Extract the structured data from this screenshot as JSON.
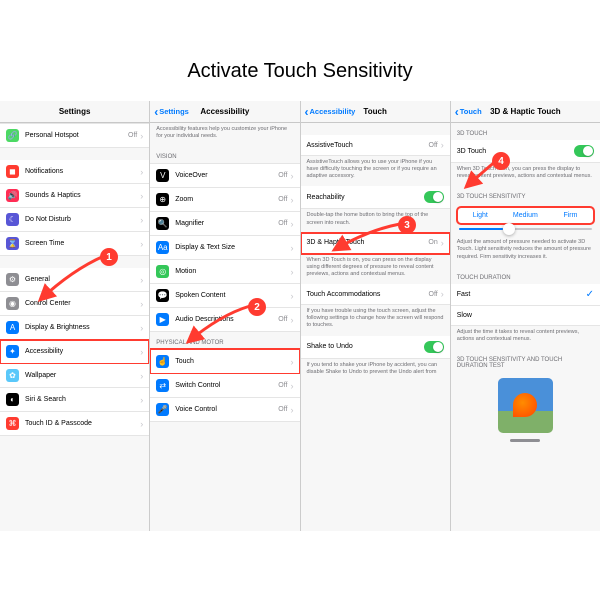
{
  "title": "Activate Touch Sensitivity",
  "panel1": {
    "header": "Settings",
    "items": [
      {
        "icon": "🔗",
        "bg": "#4cd964",
        "label": "Personal Hotspot",
        "value": "Off"
      },
      {
        "icon": "◼",
        "bg": "#ff3b30",
        "label": "Notifications"
      },
      {
        "icon": "🔊",
        "bg": "#ff2d55",
        "label": "Sounds & Haptics"
      },
      {
        "icon": "☾",
        "bg": "#5856d6",
        "label": "Do Not Disturb"
      },
      {
        "icon": "⌛",
        "bg": "#5856d6",
        "label": "Screen Time"
      },
      {
        "icon": "⚙",
        "bg": "#8e8e93",
        "label": "General"
      },
      {
        "icon": "◉",
        "bg": "#8e8e93",
        "label": "Control Center"
      },
      {
        "icon": "A",
        "bg": "#007aff",
        "label": "Display & Brightness"
      },
      {
        "icon": "✦",
        "bg": "#007aff",
        "label": "Accessibility",
        "highlight": true
      },
      {
        "icon": "✿",
        "bg": "#5ac8fa",
        "label": "Wallpaper"
      },
      {
        "icon": "◐",
        "bg": "#000",
        "label": "Siri & Search"
      },
      {
        "icon": "⌘",
        "bg": "#ff3b30",
        "label": "Touch ID & Passcode"
      }
    ]
  },
  "panel2": {
    "back": "Settings",
    "header": "Accessibility",
    "intro": "Accessibility features help you customize your iPhone for your individual needs.",
    "section1": "VISION",
    "vision": [
      {
        "icon": "V",
        "bg": "#000",
        "label": "VoiceOver",
        "value": "Off"
      },
      {
        "icon": "⊕",
        "bg": "#000",
        "label": "Zoom",
        "value": "Off"
      },
      {
        "icon": "🔍",
        "bg": "#000",
        "label": "Magnifier",
        "value": "Off"
      },
      {
        "icon": "Aa",
        "bg": "#007aff",
        "label": "Display & Text Size"
      },
      {
        "icon": "◎",
        "bg": "#34c759",
        "label": "Motion"
      },
      {
        "icon": "💬",
        "bg": "#000",
        "label": "Spoken Content"
      },
      {
        "icon": "▶",
        "bg": "#007aff",
        "label": "Audio Descriptions",
        "value": "Off"
      }
    ],
    "section2": "PHYSICAL AND MOTOR",
    "motor": [
      {
        "icon": "☝",
        "bg": "#007aff",
        "label": "Touch",
        "highlight": true
      },
      {
        "icon": "⇄",
        "bg": "#007aff",
        "label": "Switch Control",
        "value": "Off"
      },
      {
        "icon": "🎤",
        "bg": "#007aff",
        "label": "Voice Control",
        "value": "Off"
      }
    ]
  },
  "panel3": {
    "back": "Accessibility",
    "header": "Touch",
    "assistive": {
      "label": "AssistiveTouch",
      "value": "Off",
      "desc": "AssistiveTouch allows you to use your iPhone if you have difficulty touching the screen or if you require an adaptive accessory."
    },
    "reach": {
      "label": "Reachability",
      "on": true,
      "desc": "Double-tap the home button to bring the top of the screen into reach."
    },
    "haptic": {
      "label": "3D & Haptic Touch",
      "value": "On",
      "desc": "When 3D Touch is on, you can press on the display using different degrees of pressure to reveal content previews, actions and contextual menus."
    },
    "accom": {
      "label": "Touch Accommodations",
      "value": "Off",
      "desc": "If you have trouble using the touch screen, adjust the following settings to change how the screen will respond to touches."
    },
    "shake": {
      "label": "Shake to Undo",
      "on": true,
      "desc": "If you tend to shake your iPhone by accident, you can disable Shake to Undo to prevent the Undo alert from"
    }
  },
  "panel4": {
    "back": "Touch",
    "header": "3D & Haptic Touch",
    "sec1": "3D TOUCH",
    "toggle": {
      "label": "3D Touch",
      "desc": "When 3D Touch is on, you can press the display to reveal content previews, actions and contextual menus."
    },
    "sec2": "3D TOUCH SENSITIVITY",
    "seg": [
      "Light",
      "Medium",
      "Firm"
    ],
    "segDesc": "Adjust the amount of pressure needed to activate 3D Touch. Light sensitivity reduces the amount of pressure required. Firm sensitivity increases it.",
    "sec3": "TOUCH DURATION",
    "dur": [
      {
        "label": "Fast",
        "sel": true
      },
      {
        "label": "Slow"
      }
    ],
    "durDesc": "Adjust the time it takes to reveal content previews, actions and contextual menus.",
    "sec4": "3D TOUCH SENSITIVITY AND TOUCH DURATION TEST"
  },
  "badges": {
    "1": "1",
    "2": "2",
    "3": "3",
    "4": "4"
  }
}
